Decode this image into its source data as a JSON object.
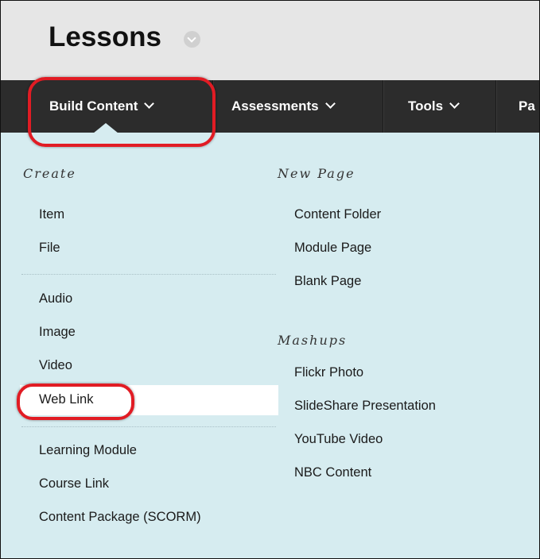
{
  "page": {
    "title": "Lessons"
  },
  "nav": {
    "items": [
      {
        "label": "Build Content"
      },
      {
        "label": "Assessments"
      },
      {
        "label": "Tools"
      },
      {
        "label": "Pa"
      }
    ]
  },
  "menu": {
    "left": {
      "heading": "Create",
      "group1": [
        "Item",
        "File"
      ],
      "group2": [
        "Audio",
        "Image",
        "Video",
        "Web Link"
      ],
      "group3": [
        "Learning Module",
        "Course Link",
        "Content Package (SCORM)"
      ]
    },
    "right": {
      "new_page_heading": "New Page",
      "new_page_items": [
        "Content Folder",
        "Module Page",
        "Blank Page"
      ],
      "mashups_heading": "Mashups",
      "mashups_items": [
        "Flickr Photo",
        "SlideShare Presentation",
        "YouTube Video",
        "NBC Content"
      ]
    },
    "selected_item": "Web Link"
  },
  "colors": {
    "nav_bg": "#2c2c2c",
    "menu_bg": "#d6ecf0",
    "highlight_ring": "#e11c24",
    "header_bg": "#e6e6e6"
  }
}
